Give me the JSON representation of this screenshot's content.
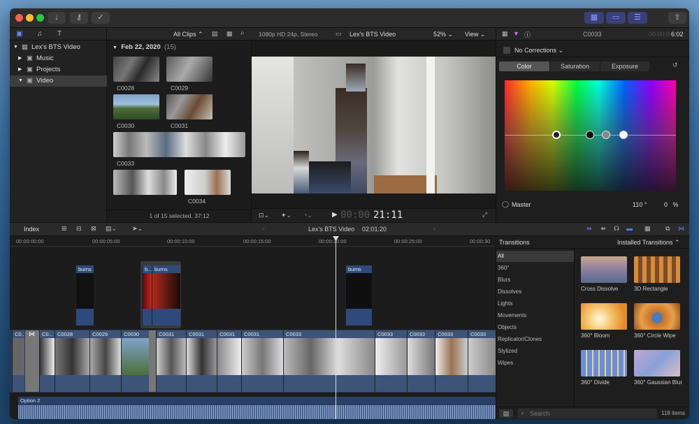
{
  "library": {
    "name": "Lex's BTS Video",
    "items": [
      "Music",
      "Projects",
      "Video"
    ]
  },
  "browser": {
    "filter": "All Clips",
    "date_group": "Feb 22, 2020",
    "group_count": "(15)",
    "clips": [
      "C0028",
      "C0029",
      "C0030",
      "C0031",
      "C0033",
      "C0034"
    ],
    "status": "1 of 15 selected, 37:12"
  },
  "viewer": {
    "format": "1080p HD 24p, Stereo",
    "title": "Lex's BTS Video",
    "zoom": "52%",
    "view_label": "View",
    "timecode_dim": "00:00",
    "timecode": "21:11"
  },
  "inspector": {
    "clip_name": "C0033",
    "duration_dim": "00:00:0",
    "duration": "6:02",
    "corrections": "No Corrections",
    "tabs": [
      "Color",
      "Saturation",
      "Exposure"
    ],
    "active_tab": "Color",
    "master_label": "Master",
    "master_value": "110",
    "degree": "°",
    "master_pct_value": "0",
    "percent": "%"
  },
  "timeline_bar": {
    "index_label": "Index",
    "project": "Lex's BTS Video",
    "duration": "02:01:20"
  },
  "ruler": [
    "00:00:00:00",
    "00:00:05:00",
    "00:00:10:00",
    "00:00:15:00",
    "00:00:20:00",
    "00:00:25:00",
    "00:00:30"
  ],
  "connected": [
    "burns",
    "b...",
    "burns",
    "burns"
  ],
  "storyline": [
    "C0...",
    "C0...",
    "C0028",
    "C0029",
    "C0030",
    "C0031",
    "C0031",
    "C0031",
    "C0031",
    "C0033",
    "C0033",
    "C0033",
    "C0033",
    "C0033"
  ],
  "audio_role": "Option 2",
  "transitions": {
    "header": "Transitions",
    "source": "Installed Transitions",
    "categories": [
      "All",
      "360°",
      "Blurs",
      "Dissolves",
      "Lights",
      "Movements",
      "Objects",
      "Replicator/Clones",
      "Stylized",
      "Wipes"
    ],
    "items": [
      "Cross Dissolve",
      "3D Rectangle",
      "360° Bloom",
      "360° Circle Wipe",
      "360° Divide",
      "360° Gaussian Blur"
    ],
    "search_placeholder": "Search",
    "count": "118 items"
  }
}
